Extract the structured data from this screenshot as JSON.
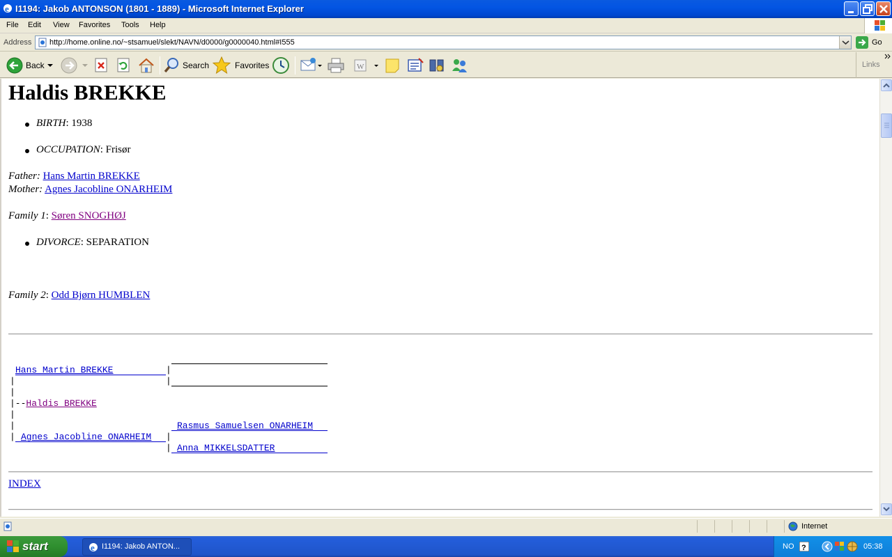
{
  "window": {
    "title": "I1194: Jakob ANTONSON (1801 - 1889) - Microsoft Internet Explorer"
  },
  "menu": [
    "File",
    "Edit",
    "View",
    "Favorites",
    "Tools",
    "Help"
  ],
  "address": {
    "label": "Address",
    "url": "http://home.online.no/~stsamuel/slekt/NAVN/d0000/g0000040.html#I555",
    "go_label": "Go"
  },
  "toolbar": {
    "back_label": "Back",
    "search_label": "Search",
    "favorites_label": "Favorites",
    "links_label": "Links"
  },
  "page": {
    "heading": "Haldis BREKKE",
    "birth_label": "BIRTH",
    "birth_value": ": 1938",
    "occupation_label": "OCCUPATION",
    "occupation_value": ": Frisør",
    "father_label": "Father:",
    "father_name": "Hans Martin BREKKE",
    "mother_label": "Mother:",
    "mother_name": "Agnes Jacobline ONARHEIM",
    "family1_label": "Family 1",
    "family1_sep": ":",
    "family1_name": "Søren SNOGHØJ",
    "divorce_label": "DIVORCE",
    "divorce_value": ": SEPARATION",
    "family2_label": "Family 2",
    "family2_sep": ":",
    "family2_name": "Odd Bjørn HUMBLEN",
    "tree": {
      "father": "Hans Martin BREKKE",
      "self_prefix": "|--",
      "self": "Haldis BREKKE",
      "mother": "Agnes Jacobline ONARHEIM",
      "maternal_grandfather": "Rasmus Samuelsen ONARHEIM",
      "maternal_grandmother": "Anna MIKKELSDATTER"
    },
    "index_link": "INDEX"
  },
  "status": {
    "zone": "Internet"
  },
  "taskbar": {
    "start_label": "start",
    "task_label": "I1194: Jakob ANTON...",
    "language": "NO",
    "clock": "05:38"
  }
}
